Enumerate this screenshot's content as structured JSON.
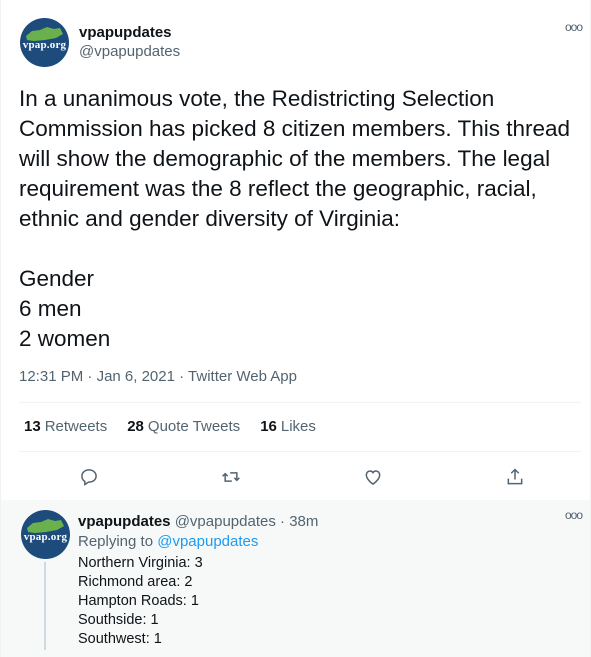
{
  "tweet": {
    "display_name": "vpapupdates",
    "handle": "@vpapupdates",
    "avatar_brand": "vpap.org",
    "text": "In a unanimous vote, the Redistricting Selection Commission has picked 8 citizen members. This thread will show the demographic of the members. The legal requirement was the 8 reflect the geographic, racial, ethnic and gender diversity of Virginia:\n\nGender\n6 men\n2 women",
    "time": "12:31 PM",
    "date": "Jan 6, 2021",
    "source": "Twitter Web App",
    "sep": "·",
    "more_icon": "ooo"
  },
  "stats": {
    "retweets_count": "13",
    "retweets_label": "Retweets",
    "quotes_count": "28",
    "quotes_label": "Quote Tweets",
    "likes_count": "16",
    "likes_label": "Likes"
  },
  "actions": {
    "reply_icon": "reply-icon",
    "retweet_icon": "retweet-icon",
    "like_icon": "heart-icon",
    "share_icon": "share-icon"
  },
  "reply": {
    "display_name": "vpapupdates",
    "handle": "@vpapupdates",
    "time": "38m",
    "sep": "·",
    "replying_prefix": "Replying to",
    "replying_handle": "@vpapupdates",
    "lines": [
      "Northern Virginia: 3",
      "Richmond area: 2",
      "Hampton Roads: 1",
      "Southside: 1",
      "Southwest: 1"
    ]
  },
  "colors": {
    "text": "#0f1419",
    "secondary": "#536471",
    "link": "#1d9bf0",
    "avatar_bg": "#1d4b7c",
    "avatar_state": "#6ab04c"
  }
}
